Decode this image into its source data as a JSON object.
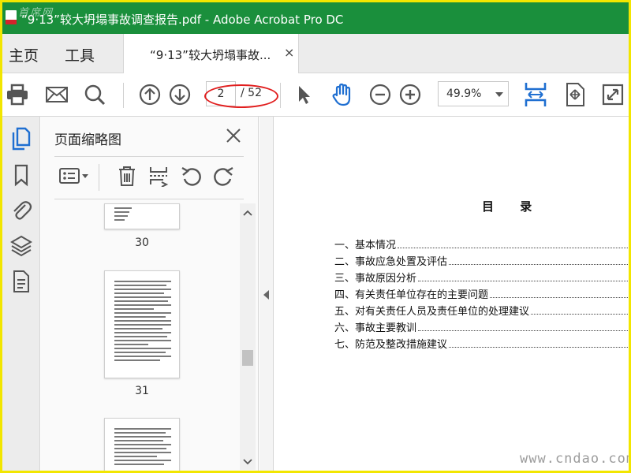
{
  "window": {
    "title": "“9·13”较大坍塌事故调查报告.pdf - Adobe Acrobat Pro DC",
    "corner_watermark": "首席网"
  },
  "tabs": {
    "home": "主页",
    "tools": "工具",
    "document": "“9·13”较大坍塌事故...",
    "close_glyph": "×"
  },
  "toolbar": {
    "current_page": "2",
    "total_pages": "/ 52",
    "zoom": "49.9%",
    "accent_color": "#1f6fd1",
    "annotation_color": "#e11e1e"
  },
  "thumbnails_panel": {
    "title": "页面缩略图",
    "pages": [
      {
        "label": "30"
      },
      {
        "label": "31"
      }
    ]
  },
  "document": {
    "toc_title": "目 录",
    "toc_items": [
      "一、基本情况",
      "二、事故应急处置及评估",
      "三、事故原因分析",
      "四、有关责任单位存在的主要问题",
      "五、对有关责任人员及责任单位的处理建议",
      "六、事故主要教训",
      "七、防范及整改措施建议"
    ],
    "watermark": "www.cndao.com"
  },
  "theme": {
    "titlebar_bg": "#1a8f3c",
    "border_color": "#f2e600"
  }
}
